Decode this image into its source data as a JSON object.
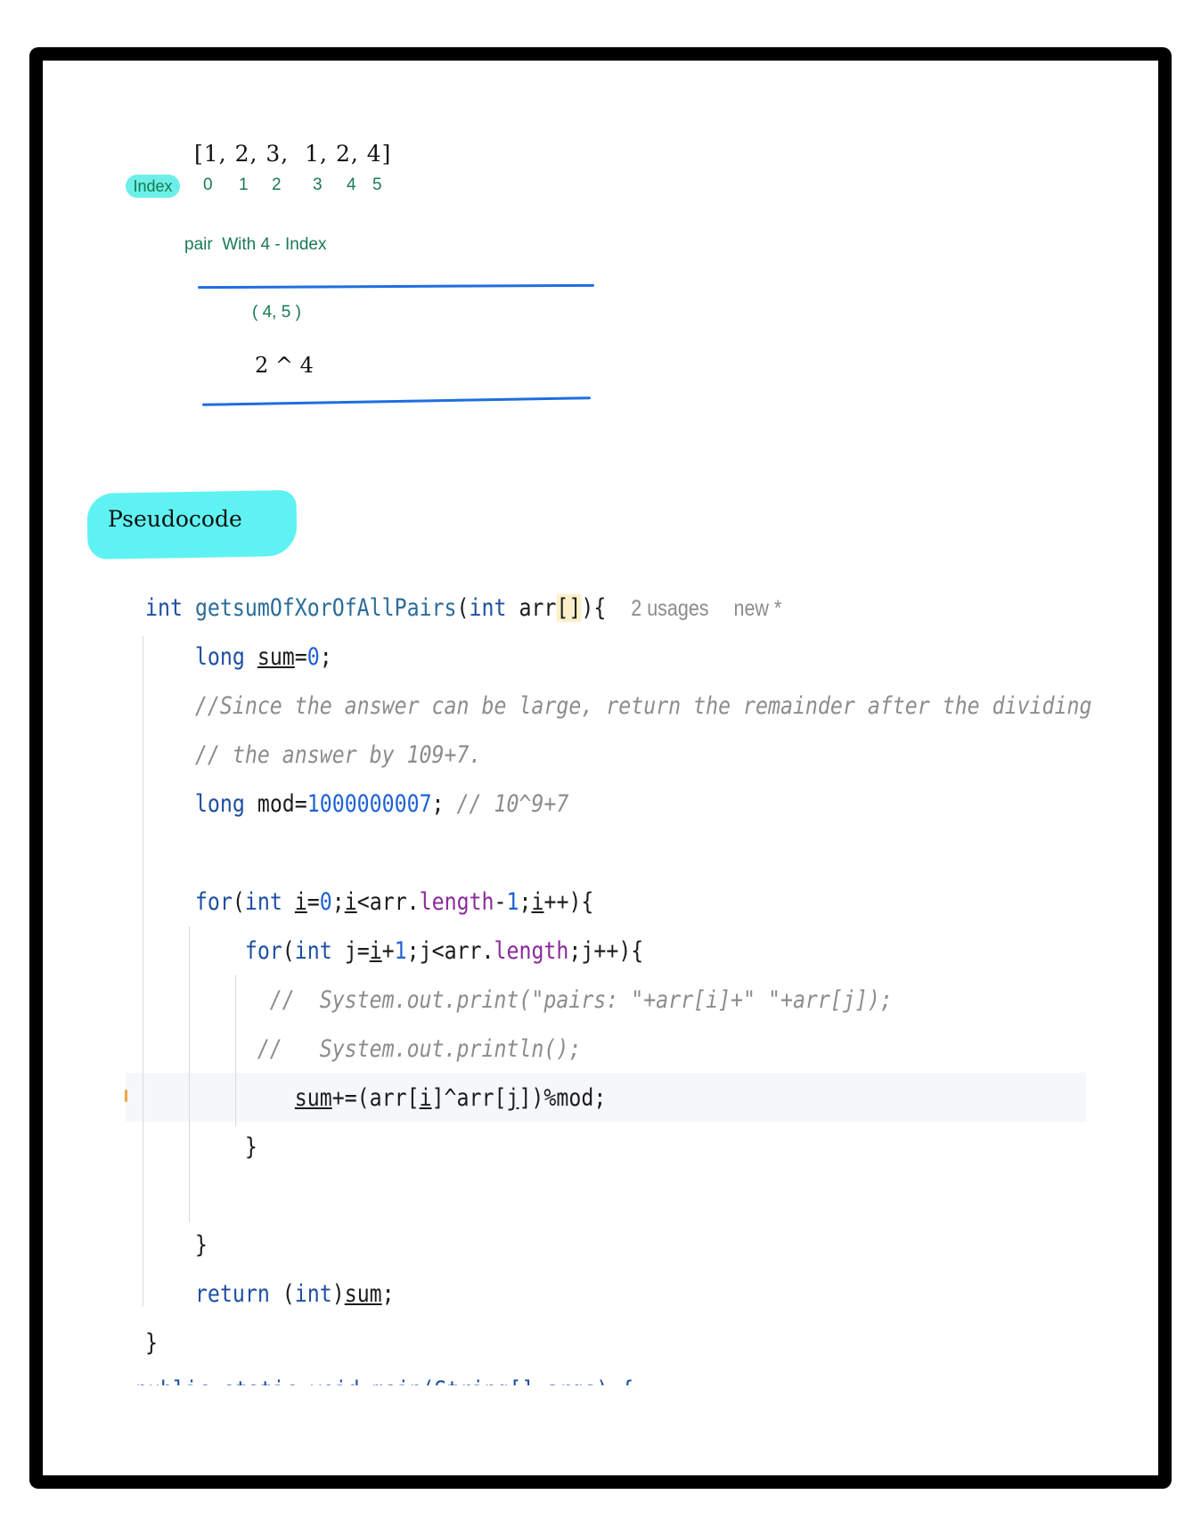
{
  "array": {
    "values": [
      "[1,",
      "2,",
      "3,",
      "1,",
      "2,",
      "4]"
    ],
    "index_label": "Index",
    "indices": [
      "0",
      "1",
      "2",
      "3",
      "4",
      "5"
    ]
  },
  "pair_note": "pair  With 4 - Index",
  "pair_value": "( 4, 5 )",
  "xor_expression": "2 ^ 4",
  "pseudocode_title": "Pseudocode",
  "code": {
    "signature_kw": "int",
    "function_name": "getsumOfXorOfAllPairs",
    "signature_rest_a": "(",
    "signature_kw2": "int",
    "signature_param": " arr",
    "signature_brackets": "[]",
    "signature_end": "){",
    "usages_hint": "2 usages",
    "new_hint": "new *",
    "l1_kw": "long",
    "l1_var": "sum",
    "l1_eq": "=",
    "l1_num": "0",
    "l1_end": ";",
    "comment1": "//Since the answer can be large, return the remainder after the dividing",
    "comment2": "// the answer by 109+7.",
    "l4_kw": "long",
    "l4_rest": " mod=",
    "l4_num": "1000000007",
    "l4_semi": "; ",
    "l4_comment": "// 10^9+7",
    "for1_kw": "for",
    "for1_open": "(",
    "for1_int": "int",
    "for1_sp": " ",
    "for1_i1": "i",
    "for1_eq": "=",
    "for1_zero": "0",
    "for1_semi1": ";",
    "for1_i2": "i",
    "for1_lt": "<arr.",
    "for1_len": "length",
    "for1_minus": "-",
    "for1_one": "1",
    "for1_semi2": ";",
    "for1_i3": "i",
    "for1_end": "++){",
    "for2_kw": "for",
    "for2_open": "(",
    "for2_int": "int",
    "for2_j": " j=",
    "for2_i": "i",
    "for2_plus": "+",
    "for2_one": "1",
    "for2_rest": ";j<arr.",
    "for2_len": "length",
    "for2_end": ";j++){",
    "comment_pairs": "//  System.out.print(\"pairs: \"+arr[i]+\" \"+arr[j]);",
    "comment_println": "//   System.out.println();",
    "sum_var": "sum",
    "sum_rest_a": "+=(arr[",
    "sum_i": "i",
    "sum_rest_b": "]^arr[",
    "sum_j": "j",
    "sum_rest_c": "])%mod;",
    "close_inner": "}",
    "close_outer": "}",
    "return_kw": "return",
    "return_rest_a": " (",
    "return_int": "int",
    "return_rest_b": ")",
    "return_var": "sum",
    "return_end": ";",
    "close_fn": "}",
    "next_line_fragment": "public static void main(String[] args) {"
  }
}
